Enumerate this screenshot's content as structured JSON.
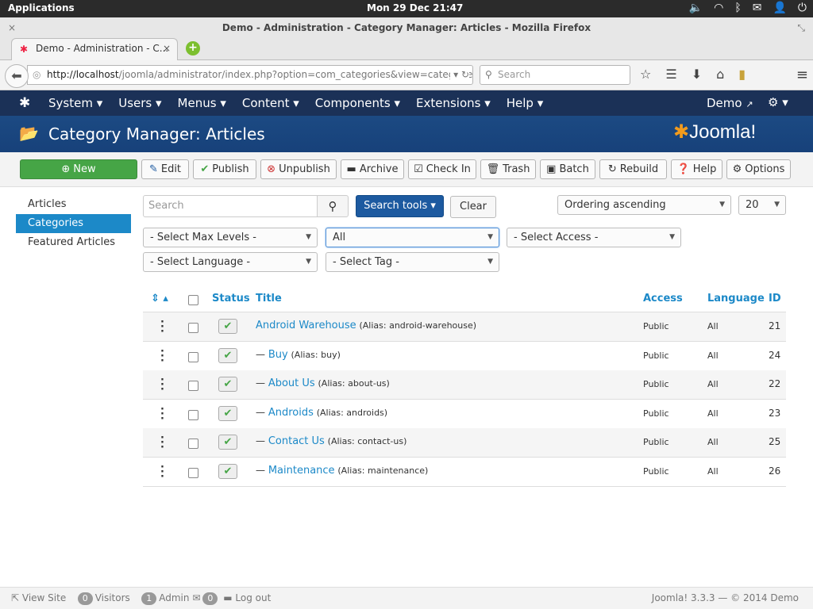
{
  "desktop": {
    "apps": "Applications",
    "clock": "Mon 29 Dec 21:47"
  },
  "window": {
    "title": "Demo - Administration - Category Manager: Articles - Mozilla Firefox"
  },
  "tab": {
    "label": "Demo - Administration - C...",
    "close": "×",
    "new_tab": "+"
  },
  "browser": {
    "url_host": "http://localhost",
    "url_path": "/joomla/administrator/index.php?option=com_categories&view=categories&ex",
    "search_placeholder": "Search"
  },
  "jmenu": {
    "items": [
      "System ▾",
      "Users ▾",
      "Menus ▾",
      "Content ▾",
      "Components ▾",
      "Extensions ▾",
      "Help ▾"
    ],
    "site": "Demo",
    "brand": "Joomla!"
  },
  "page": {
    "title": "Category Manager: Articles"
  },
  "toolbar": {
    "new": "New",
    "edit": "Edit",
    "publish": "Publish",
    "unpublish": "Unpublish",
    "archive": "Archive",
    "checkin": "Check In",
    "trash": "Trash",
    "batch": "Batch",
    "rebuild": "Rebuild",
    "help": "Help",
    "options": "Options"
  },
  "sidebar": {
    "items": [
      "Articles",
      "Categories",
      "Featured Articles"
    ],
    "active": "Categories"
  },
  "filters": {
    "search_placeholder": "Search",
    "search_tools": "Search tools ▾",
    "clear": "Clear",
    "ordering": "Ordering ascending",
    "limit": "20",
    "max_levels": "- Select Max Levels -",
    "state": "All",
    "access": "- Select Access -",
    "language": "- Select Language -",
    "tag": "- Select Tag -"
  },
  "table": {
    "headers": {
      "status": "Status",
      "title": "Title",
      "access": "Access",
      "language": "Language",
      "id": "ID"
    },
    "rows": [
      {
        "prefix": "",
        "title": "Android Warehouse",
        "alias": "(Alias: android-warehouse)",
        "access": "Public",
        "language": "All",
        "id": "21"
      },
      {
        "prefix": "— ",
        "title": "Buy",
        "alias": "(Alias: buy)",
        "access": "Public",
        "language": "All",
        "id": "24"
      },
      {
        "prefix": "— ",
        "title": "About Us",
        "alias": "(Alias: about-us)",
        "access": "Public",
        "language": "All",
        "id": "22"
      },
      {
        "prefix": "— ",
        "title": "Androids",
        "alias": "(Alias: androids)",
        "access": "Public",
        "language": "All",
        "id": "23"
      },
      {
        "prefix": "— ",
        "title": "Contact Us",
        "alias": "(Alias: contact-us)",
        "access": "Public",
        "language": "All",
        "id": "25"
      },
      {
        "prefix": "— ",
        "title": "Maintenance",
        "alias": "(Alias: maintenance)",
        "access": "Public",
        "language": "All",
        "id": "26"
      }
    ]
  },
  "footer": {
    "view_site": "View Site",
    "visitors_count": "0",
    "visitors": "Visitors",
    "admin_count": "1",
    "admin": "Admin",
    "messages_count": "0",
    "logout": "Log out",
    "version": "Joomla! 3.3.3 — © 2014 Demo"
  },
  "colors": {
    "nav": "#1b3157",
    "header": "#17417a",
    "accent": "#1c89c8",
    "new_button": "#46a546",
    "search_tools": "#1d5aa0"
  }
}
